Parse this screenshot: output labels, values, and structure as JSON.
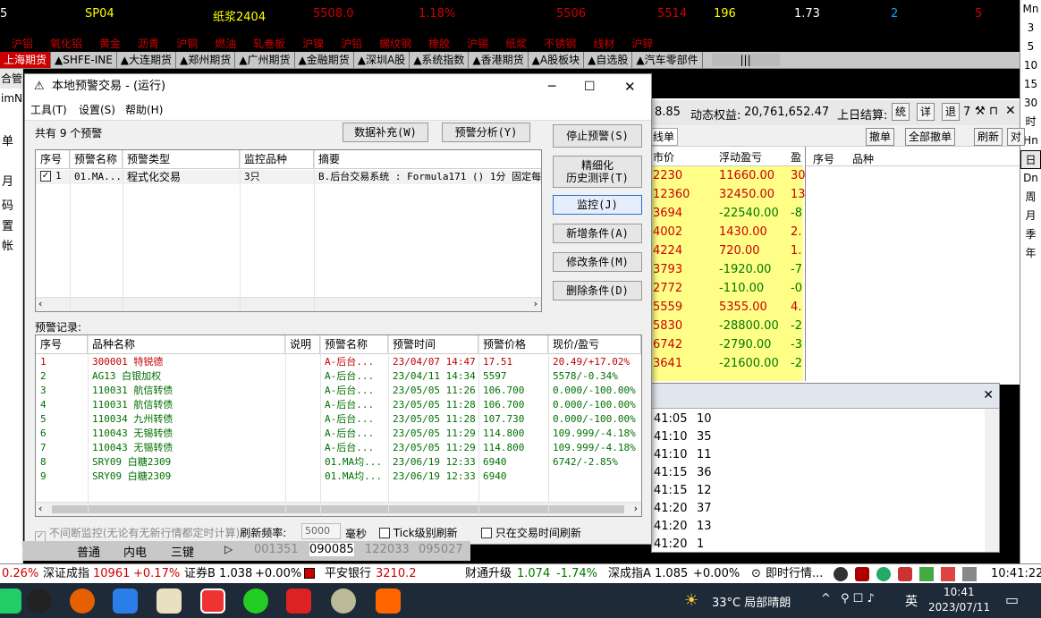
{
  "quote_row": {
    "code": "SP04",
    "name": "纸浆2404",
    "price": "5508.0",
    "change_pct": "1.18%",
    "bid": "5506",
    "ask": "5514",
    "vol": "196",
    "ratio": "1.73",
    "bid_size": "2",
    "ask_size": "5"
  },
  "ticker_items": [
    "沪铝",
    "氧化铝",
    "黄金",
    "沥青",
    "沪铜",
    "燃油",
    "轧卷板",
    "沪镍",
    "沪铅",
    "螺纹钢",
    "橡胶",
    "沪锡",
    "纸浆",
    "不锈钢",
    "线材",
    "沪锌"
  ],
  "market_tabs": [
    "上海期货",
    "▲SHFE-INE",
    "▲大连期货",
    "▲郑州期货",
    "▲广州期货",
    "▲金融期货",
    "▲深圳A股",
    "▲系统指数",
    "▲香港期货",
    "▲A股板块",
    "▲自选股",
    "▲汽车零部件"
  ],
  "right_periods": [
    "Mn",
    "3",
    "5",
    "10",
    "15",
    "30",
    "时",
    "Hn",
    "日",
    "Dn",
    "周",
    "月",
    "季",
    "年"
  ],
  "left_pane": {
    "tab": "合管",
    "sub": "imN",
    "items": [
      "单",
      "月",
      "码",
      "置",
      "帐"
    ]
  },
  "trade": {
    "price_fragment": "8.85",
    "equity_label": "动态权益:",
    "equity_value": "20,761,652.47",
    "settle_label": "上日结算:",
    "btn_a": "统",
    "btn_b": "详",
    "btn_c": "退",
    "risk": "7",
    "kline_tab": "线单",
    "cancel": "撤单",
    "cancel_all": "全部撤单",
    "refresh": "刷新",
    "col_price": "市价",
    "col_pnl": "浮动盈亏",
    "col_extra": "盈",
    "order_col_no": "序号",
    "order_col_sym": "品种",
    "positions": [
      {
        "price": "2230",
        "pnl": "11660.00",
        "x": "30"
      },
      {
        "price": "12360",
        "pnl": "32450.00",
        "x": "13"
      },
      {
        "price": "3694",
        "pnl": "-22540.00",
        "x": "-8"
      },
      {
        "price": "4002",
        "pnl": "1430.00",
        "x": "2."
      },
      {
        "price": "4224",
        "pnl": "720.00",
        "x": "1."
      },
      {
        "price": "3793",
        "pnl": "-1920.00",
        "x": "-7"
      },
      {
        "price": "2772",
        "pnl": "-110.00",
        "x": "-0"
      },
      {
        "price": "5559",
        "pnl": "5355.00",
        "x": "4."
      },
      {
        "price": "5830",
        "pnl": "-28800.00",
        "x": "-2"
      },
      {
        "price": "6742",
        "pnl": "-2790.00",
        "x": "-3"
      },
      {
        "price": "3641",
        "pnl": "-21600.00",
        "x": "-2"
      }
    ]
  },
  "ticks": [
    [
      "41:05",
      "10"
    ],
    [
      "41:10",
      "35"
    ],
    [
      "41:10",
      "11"
    ],
    [
      "41:15",
      "36"
    ],
    [
      "41:15",
      "12"
    ],
    [
      "41:20",
      "37"
    ],
    [
      "41:20",
      "13"
    ],
    [
      "41:20",
      "1"
    ]
  ],
  "dialog": {
    "title": "本地预警交易 - (运行)",
    "menu": [
      "工具(T)",
      "设置(S)",
      "帮助(H)"
    ],
    "count_label": "共有 9 个预警",
    "btn_fill": "数据补充(W)",
    "btn_analysis": "预警分析(Y)",
    "btn_stop": "停止预警(S)",
    "btn_eval_1": "精细化",
    "btn_eval_2": "历史测评(T)",
    "btn_monitor": "监控(J)",
    "btn_add": "新增条件(A)",
    "btn_edit": "修改条件(M)",
    "btn_delete": "删除条件(D)",
    "alert_headers": [
      "序号",
      "预警名称",
      "预警类型",
      "监控品种",
      "摘要"
    ],
    "alerts": [
      {
        "no": "1",
        "name": "01.MA...",
        "type": "程式化交易",
        "symbols": "3只",
        "summary": "B.后台交易系统 : Formula171 () 1分 固定每"
      }
    ],
    "record_label": "预警记录:",
    "record_headers": [
      "序号",
      "品种名称",
      "说明",
      "预警名称",
      "预警时间",
      "预警价格",
      "现价/盈亏"
    ],
    "records": [
      {
        "no": "1",
        "sym": "300001 特锐德",
        "desc": "",
        "name": "A-后台...",
        "time": "23/04/07 14:47",
        "price": "17.51",
        "now": "20.49/+17.02%",
        "color": "red"
      },
      {
        "no": "2",
        "sym": "AG13 白银加权",
        "desc": "",
        "name": "A-后台...",
        "time": "23/04/11 14:34",
        "price": "5597",
        "now": "5578/-0.34%",
        "color": "green"
      },
      {
        "no": "3",
        "sym": "110031 航信转债",
        "desc": "",
        "name": "A-后台...",
        "time": "23/05/05 11:26",
        "price": "106.700",
        "now": "0.000/-100.00%",
        "color": "green"
      },
      {
        "no": "4",
        "sym": "110031 航信转债",
        "desc": "",
        "name": "A-后台...",
        "time": "23/05/05 11:28",
        "price": "106.700",
        "now": "0.000/-100.00%",
        "color": "green"
      },
      {
        "no": "5",
        "sym": "110034 九州转债",
        "desc": "",
        "name": "A-后台...",
        "time": "23/05/05 11:28",
        "price": "107.730",
        "now": "0.000/-100.00%",
        "color": "green"
      },
      {
        "no": "6",
        "sym": "110043 无锡转债",
        "desc": "",
        "name": "A-后台...",
        "time": "23/05/05 11:29",
        "price": "114.800",
        "now": "109.999/-4.18%",
        "color": "green"
      },
      {
        "no": "7",
        "sym": "110043 无锡转债",
        "desc": "",
        "name": "A-后台...",
        "time": "23/05/05 11:29",
        "price": "114.800",
        "now": "109.999/-4.18%",
        "color": "green"
      },
      {
        "no": "8",
        "sym": "SRY09 白糖2309",
        "desc": "",
        "name": "01.MA均...",
        "time": "23/06/19 12:33",
        "price": "6940",
        "now": "6742/-2.85%",
        "color": "green"
      },
      {
        "no": "9",
        "sym": "SRY09 白糖2309",
        "desc": "",
        "name": "01.MA均...",
        "time": "23/06/19 12:33",
        "price": "6940",
        "now": "",
        "color": "green"
      }
    ],
    "continuous_label": "不间断监控(无论有无新行情都定时计算)",
    "refresh_label": "刷新频率:",
    "refresh_value": "5000",
    "ms_label": "毫秒",
    "tick_refresh": "Tick级别刷新",
    "trading_only": "只在交易时间刷新"
  },
  "bottom_tabs": [
    "普通",
    "内电",
    "三键"
  ],
  "bottom_codes": [
    "001351",
    "090085",
    "122033",
    "095027"
  ],
  "status": {
    "s1": "0.26%",
    "s2": "深证成指",
    "s3": "10961",
    "s4": "+0.17%",
    "s5": "证券B 1.038",
    "s6": "+0.00%",
    "s7": "平安银行",
    "s8": "3210.2",
    "s9": "财通升级",
    "s10": "1.074",
    "s11": "-1.74%",
    "s12": "深成指A 1.085",
    "s13": "+0.00%",
    "s14": "即时行情...",
    "clock": "10:41:22"
  },
  "taskbar": {
    "weather": "33°C 局部晴朗",
    "ime": "英",
    "time": "10:41",
    "date": "2023/07/11"
  },
  "colors": {
    "red": "#c00000",
    "green": "#007000",
    "accent": "#c00"
  }
}
